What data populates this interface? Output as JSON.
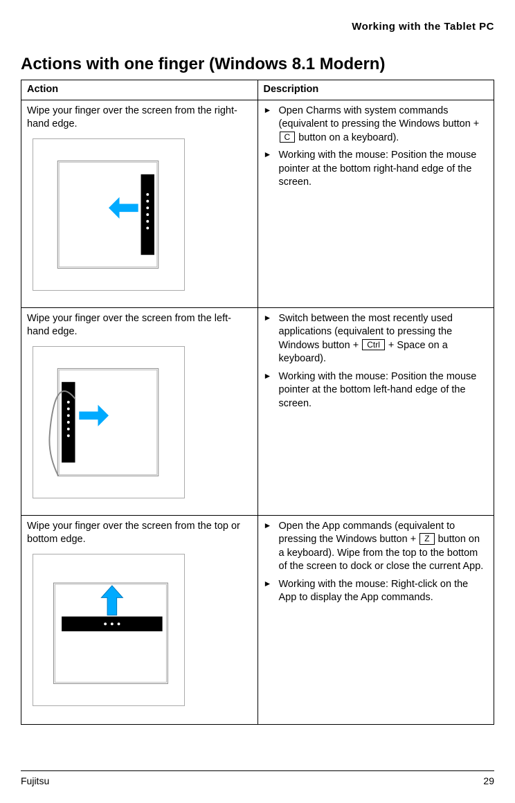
{
  "header": {
    "category": "Working with the Tablet PC"
  },
  "section": {
    "title": "Actions with one finger (Windows 8.1 Modern)"
  },
  "table": {
    "headers": {
      "action": "Action",
      "description": "Description"
    },
    "rows": [
      {
        "action": "Wipe your finger over the screen from the right-hand edge.",
        "bullets": [
          {
            "pre": "Open Charms with system commands (equivalent to pressing the Windows button + ",
            "kbd": "C",
            "post": " button on a keyboard)."
          },
          {
            "pre": "Working with the mouse: Position the mouse pointer at the bottom right-hand edge of the screen.",
            "kbd": "",
            "post": ""
          }
        ]
      },
      {
        "action": "Wipe your finger over the screen from the left-hand edge.",
        "bullets": [
          {
            "pre": "Switch between the most recently used applications (equivalent to pressing the Windows button + ",
            "kbd": "Ctrl",
            "post": " + Space on a keyboard)."
          },
          {
            "pre": "Working with the mouse: Position the mouse pointer at the bottom left-hand edge of the screen.",
            "kbd": "",
            "post": ""
          }
        ]
      },
      {
        "action": "Wipe your finger over the screen from the top or bottom edge.",
        "bullets": [
          {
            "pre": "Open the App commands (equivalent to pressing the Windows button + ",
            "kbd": "Z",
            "post": " button on a keyboard). Wipe from the top to the bottom of the screen to dock or close the current App."
          },
          {
            "pre": "Working with the mouse: Right-click on the App to display the App commands.",
            "kbd": "",
            "post": ""
          }
        ]
      }
    ]
  },
  "footer": {
    "brand": "Fujitsu",
    "page": "29"
  }
}
